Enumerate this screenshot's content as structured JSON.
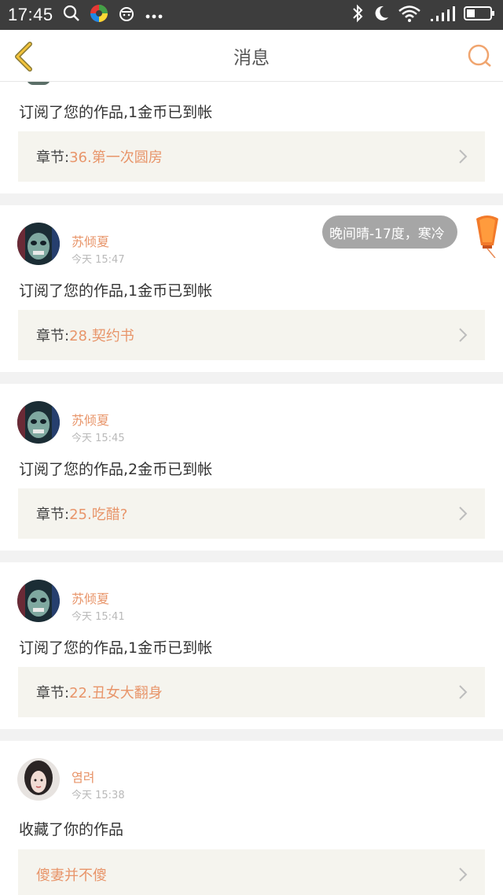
{
  "status_bar": {
    "time": "17:45"
  },
  "app_bar": {
    "title": "消息"
  },
  "weather_bubble": {
    "text": "晚间晴-17度，寒冷"
  },
  "notifications": [
    {
      "message": "订阅了您的作品,1金币已到帐",
      "chapter_label": "章节:",
      "chapter_value": "36.第一次圆房"
    },
    {
      "user": "苏倾夏",
      "time": "今天 15:47",
      "message": "订阅了您的作品,1金币已到帐",
      "chapter_label": "章节:",
      "chapter_value": "28.契约书"
    },
    {
      "user": "苏倾夏",
      "time": "今天 15:45",
      "message": "订阅了您的作品,2金币已到帐",
      "chapter_label": "章节:",
      "chapter_value": "25.吃醋?"
    },
    {
      "user": "苏倾夏",
      "time": "今天 15:41",
      "message": "订阅了您的作品,1金币已到帐",
      "chapter_label": "章节:",
      "chapter_value": "22.丑女大翻身"
    },
    {
      "user": "염려",
      "time": "今天 15:38",
      "message": "收藏了你的作品",
      "work_title": "傻妻并不傻"
    }
  ]
}
